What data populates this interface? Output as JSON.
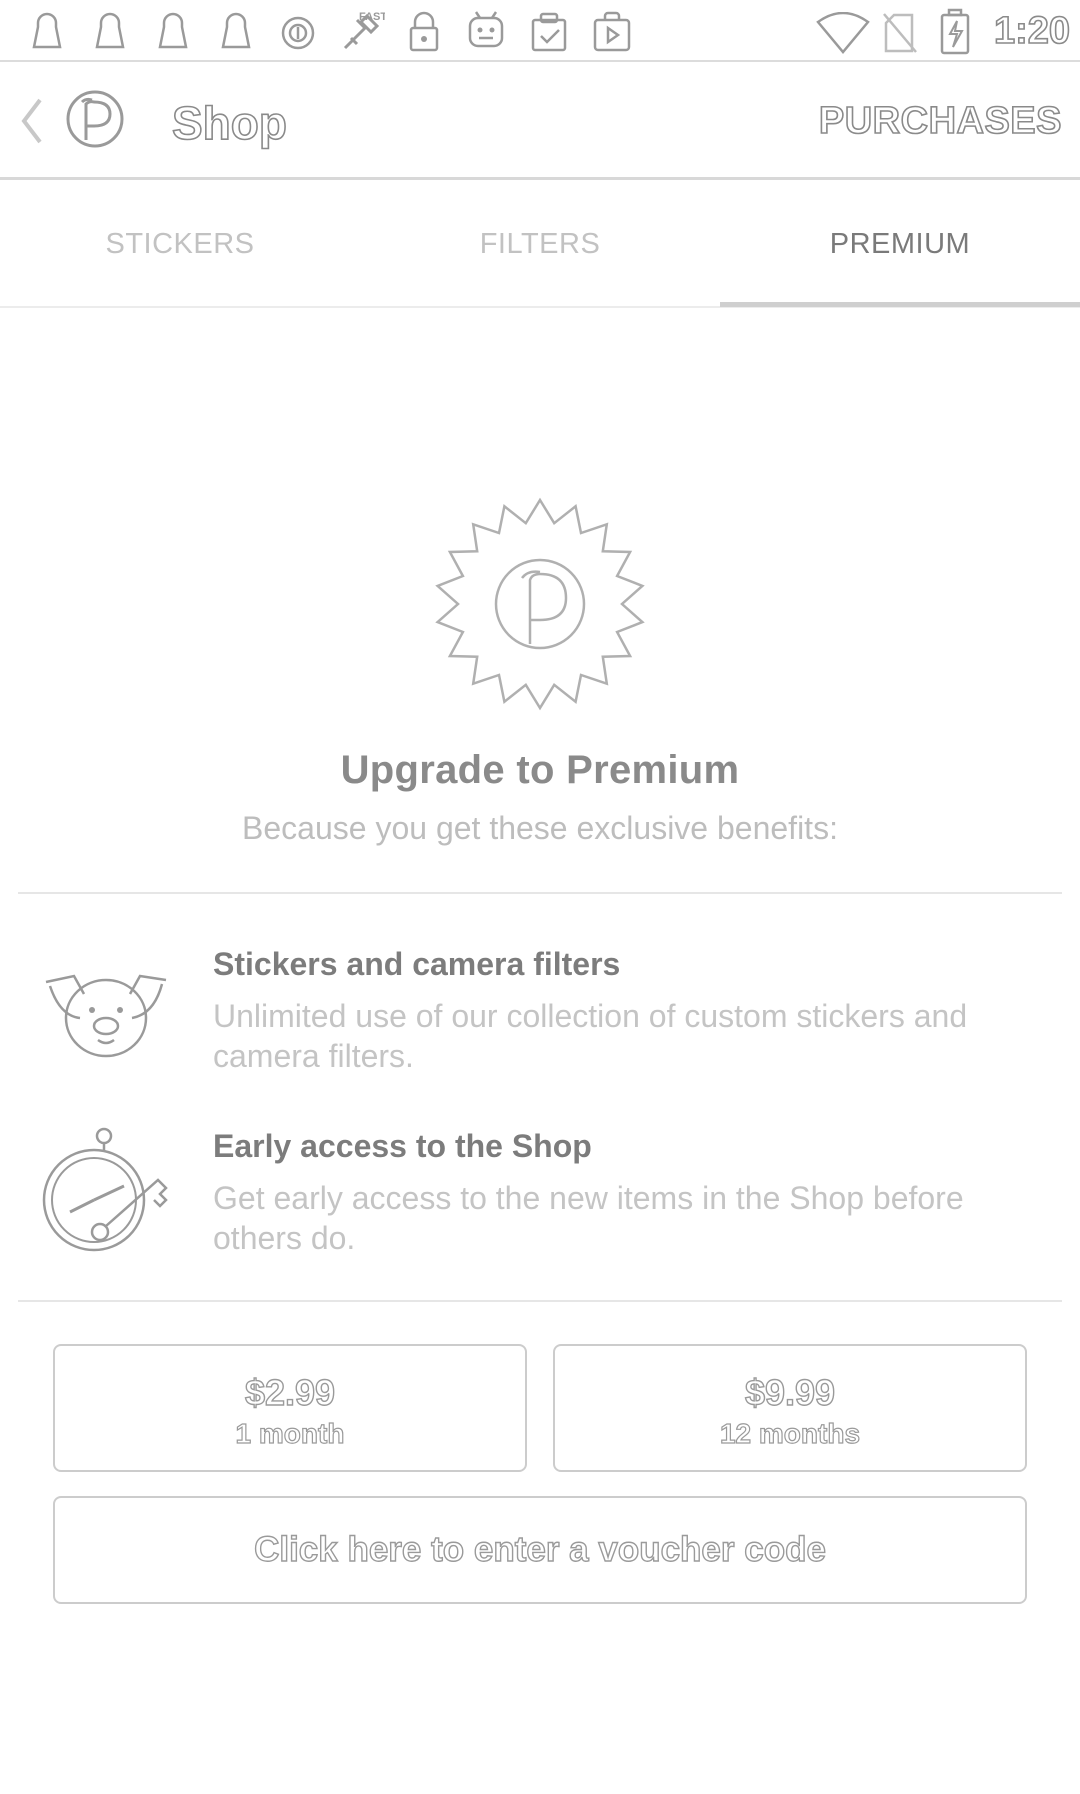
{
  "status_bar": {
    "time": "1:20",
    "icons": [
      "keyhole-icon",
      "keyhole-icon",
      "keyhole-icon",
      "keyhole-icon",
      "circle-icon",
      "fast-tool-icon",
      "lock-icon",
      "android-icon",
      "clipboard-check-icon",
      "play-bag-icon",
      "wifi-icon",
      "no-sim-icon",
      "battery-charging-icon"
    ]
  },
  "appbar": {
    "title": "Shop",
    "purchases_label": "PURCHASES",
    "back_icon": "chevron-left-icon",
    "logo_icon": "p-logo-icon"
  },
  "tabs": [
    {
      "label": "STICKERS",
      "active": false
    },
    {
      "label": "FILTERS",
      "active": false
    },
    {
      "label": "PREMIUM",
      "active": true
    }
  ],
  "premium": {
    "badge_icon": "premium-badge-icon",
    "title": "Upgrade to Premium",
    "subtitle": "Because you get these exclusive benefits:"
  },
  "benefits": [
    {
      "icon": "pig-face-icon",
      "title": "Stickers and camera filters",
      "description": "Unlimited use of our collection of custom stickers and camera filters."
    },
    {
      "icon": "stopwatch-key-icon",
      "title": "Early access to the Shop",
      "description": "Get early access to the new items in the Shop before others do."
    }
  ],
  "plans": [
    {
      "price": "$2.99",
      "period": "1 month"
    },
    {
      "price": "$9.99",
      "period": "12 months"
    }
  ],
  "voucher": {
    "label": "Click here to enter a voucher code"
  },
  "colors": {
    "outline_text": "#8a8a8a",
    "muted_text": "#c4c4c4",
    "border": "#cccccc"
  }
}
